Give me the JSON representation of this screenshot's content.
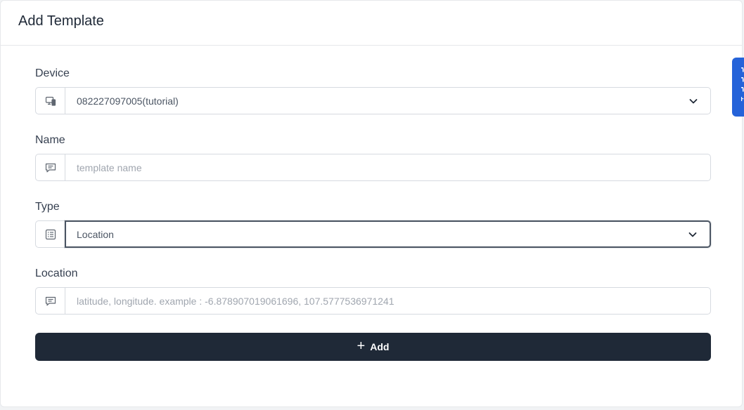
{
  "header": {
    "title": "Add Template"
  },
  "form": {
    "device": {
      "label": "Device",
      "value": "082227097005(tutorial)",
      "icon": "devices-icon"
    },
    "name": {
      "label": "Name",
      "placeholder": "template name",
      "value": "",
      "icon": "message-icon"
    },
    "type": {
      "label": "Type",
      "value": "Location",
      "icon": "list-icon"
    },
    "location": {
      "label": "Location",
      "placeholder": "latitude, longitude. example : -6.878907019061696, 107.5777536971241",
      "value": "",
      "icon": "message-icon"
    },
    "submit": {
      "label": "Add",
      "icon": "plus-icon"
    }
  },
  "side_tab": {
    "color": "#2563d9"
  },
  "colors": {
    "button_bg": "#1f2937",
    "border": "#d6dae0",
    "focus_border": "#4b5563"
  }
}
